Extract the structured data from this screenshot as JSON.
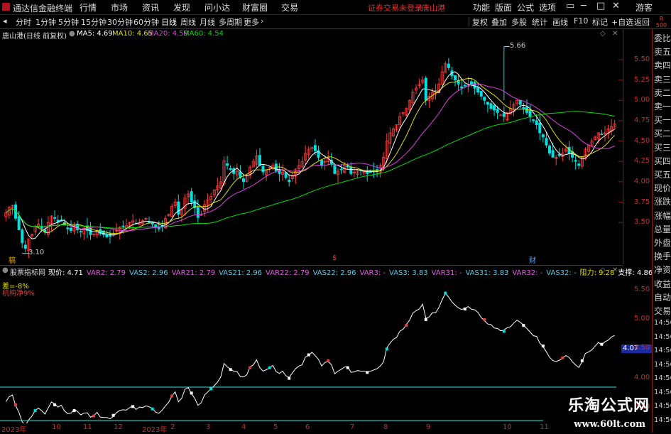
{
  "topbar": {
    "brand": "通达信金融终端",
    "menu": [
      "行情",
      "市场",
      "资讯",
      "发现",
      "问小达",
      "财富圈",
      "交易"
    ],
    "warning": "证券交易未登录",
    "stock_name": "唐山港",
    "right_menu": [
      "功能",
      "版面",
      "公式",
      "选项"
    ],
    "guest": "游客",
    "window_buttons": [
      "▭",
      "─",
      "□",
      "✕"
    ]
  },
  "toolbar": {
    "periods": [
      "分时",
      "1分钟",
      "5分钟",
      "15分钟",
      "30分钟",
      "60分钟",
      "日线",
      "周线",
      "月线",
      "多周期",
      "更多"
    ],
    "active_period": "日线",
    "actions": [
      "复权",
      "叠加",
      "多股",
      "统计",
      "画线",
      "F10",
      "标记",
      "+自选",
      "返回"
    ]
  },
  "right_label": "R\n500",
  "sidebar": [
    "委比",
    "卖五",
    "卖四",
    "卖三",
    "卖二",
    "卖一",
    "买一",
    "买二",
    "买三",
    "买四",
    "买五",
    "现价",
    "涨跌",
    "涨幅",
    "总量",
    "外盘",
    "换手",
    "净资",
    "收益",
    "自动",
    "交易"
  ],
  "main_header": {
    "title": "唐山港(日线 前复权)",
    "ma5": "MA5: 4.69",
    "ma10": "MA10: 4.65",
    "ma20": "MA20: 4.59",
    "ma60": "MA60: 4.54"
  },
  "indicator_header": {
    "name": "股票指标网",
    "items": [
      {
        "t": "现价: 4.71",
        "c": "#ffffff"
      },
      {
        "t": "VAR2: 2.79",
        "c": "#e060e0"
      },
      {
        "t": "VAS2: 2.96",
        "c": "#60c8e0"
      },
      {
        "t": "VAR21: 2.79",
        "c": "#e060e0"
      },
      {
        "t": "VAS21: 2.96",
        "c": "#60c8e0"
      },
      {
        "t": "VAR22: 2.79",
        "c": "#e060e0"
      },
      {
        "t": "VAS22: 2.96",
        "c": "#60c8e0"
      },
      {
        "t": "VAR3: -",
        "c": "#e060e0"
      },
      {
        "t": "VAS3: 3.83",
        "c": "#60c8e0"
      },
      {
        "t": "VAR31: -",
        "c": "#e060e0"
      },
      {
        "t": "VAS31: 3.83",
        "c": "#60c8e0"
      },
      {
        "t": "VAR32: -",
        "c": "#e060e0"
      },
      {
        "t": "VAS32: -",
        "c": "#60c8e0"
      },
      {
        "t": "阻力: 9.28",
        "c": "#e0e000"
      },
      {
        "t": "支撑: 4.86",
        "c": "#ffffff"
      }
    ],
    "left_text1": "差=-8%",
    "left_text2": "机构净9%",
    "current_box": "4.07"
  },
  "watermark": {
    "line1": "乐淘公式网",
    "line2": "www.60lt.com"
  },
  "annotations": {
    "low_label": "3.10",
    "high_label": "5.66",
    "marker_left": "稿",
    "marker_mid": "$",
    "marker_right": "财"
  },
  "colors": {
    "up": "#ff3c3c",
    "down": "#00e0e0",
    "ma5": "#ffffff",
    "ma10": "#e0e000",
    "ma20": "#e040e0",
    "ma60": "#00e000"
  },
  "chart_data": [
    {
      "type": "candlestick",
      "title": "唐山港(日线 前复权)",
      "ylim": [
        3.1,
        5.7
      ],
      "yticks": [
        3.5,
        3.75,
        4.0,
        4.25,
        4.5,
        4.75,
        5.0,
        5.25,
        5.5
      ],
      "x_ticks": [
        "2023年",
        "10",
        "11",
        "12",
        "2023年",
        "2",
        "3",
        "4",
        "5",
        "6",
        "7",
        "8",
        "9",
        "10",
        "11"
      ],
      "close": [
        3.62,
        3.68,
        3.71,
        3.55,
        3.41,
        3.25,
        3.18,
        3.3,
        3.35,
        3.45,
        3.48,
        3.43,
        3.38,
        3.5,
        3.58,
        3.55,
        3.5,
        3.52,
        3.47,
        3.42,
        3.4,
        3.45,
        3.41,
        3.39,
        3.43,
        3.4,
        3.35,
        3.36,
        3.4,
        3.36,
        3.35,
        3.32,
        3.33,
        3.37,
        3.4,
        3.44,
        3.45,
        3.46,
        3.5,
        3.52,
        3.49,
        3.5,
        3.52,
        3.55,
        3.5,
        3.48,
        3.45,
        3.42,
        3.45,
        3.55,
        3.6,
        3.7,
        3.75,
        3.6,
        3.66,
        3.8,
        3.85,
        3.75,
        3.68,
        3.56,
        3.6,
        3.72,
        3.78,
        3.82,
        3.9,
        3.95,
        4.0,
        4.26,
        4.2,
        4.15,
        4.1,
        4.13,
        4.05,
        4.0,
        4.08,
        4.18,
        4.25,
        4.32,
        4.2,
        4.12,
        4.14,
        4.18,
        4.2,
        4.13,
        4.1,
        4.12,
        4.05,
        4.0,
        4.08,
        4.15,
        4.2,
        4.25,
        4.35,
        4.4,
        4.42,
        4.38,
        4.3,
        4.2,
        4.25,
        4.3,
        4.22,
        4.1,
        4.13,
        4.15,
        4.2,
        4.18,
        4.1,
        4.12,
        4.15,
        4.14,
        4.13,
        4.1,
        4.11,
        4.13,
        4.15,
        4.2,
        4.3,
        4.5,
        4.6,
        4.65,
        4.7,
        4.8,
        4.85,
        4.9,
        5.0,
        5.1,
        5.15,
        5.2,
        5.25,
        5.0,
        5.05,
        5.1,
        5.12,
        5.2,
        5.35,
        5.45,
        5.4,
        5.3,
        5.25,
        5.2,
        5.15,
        5.18,
        5.2,
        5.2,
        5.15,
        5.1,
        5.05,
        5.0,
        4.95,
        4.9,
        4.88,
        4.85,
        4.82,
        4.8,
        4.85,
        4.9,
        4.95,
        5.0,
        4.95,
        4.9,
        4.85,
        4.8,
        4.75,
        4.7,
        4.6,
        4.55,
        4.45,
        4.35,
        4.3,
        4.3,
        4.32,
        4.35,
        4.4,
        4.35,
        4.3,
        4.25,
        4.2,
        4.3,
        4.4,
        4.45,
        4.5,
        4.55,
        4.6,
        4.58,
        4.6,
        4.65,
        4.68,
        4.71
      ],
      "indicator": {
        "ylim": [
          3.5,
          5.7
        ],
        "yticks": [
          3.5,
          4.0,
          4.5,
          5.0,
          5.5
        ],
        "line_value": 3.85,
        "line_value2": 3.45
      }
    }
  ]
}
